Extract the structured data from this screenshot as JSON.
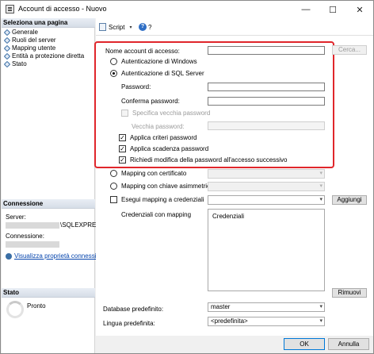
{
  "window": {
    "title": "Account di accesso - Nuovo",
    "minimize_glyph": "—",
    "maximize_glyph": "☐",
    "close_glyph": "✕"
  },
  "left_pane": {
    "select_page_header": "Seleziona una pagina",
    "pages": [
      {
        "label": "Generale",
        "icon": "wrench-icon"
      },
      {
        "label": "Ruoli del server",
        "icon": "wrench-icon"
      },
      {
        "label": "Mapping utente",
        "icon": "wrench-icon"
      },
      {
        "label": "Entità a protezione diretta",
        "icon": "wrench-icon"
      },
      {
        "label": "Stato",
        "icon": "wrench-icon"
      }
    ],
    "connection_header": "Connessione",
    "server_label": "Server:",
    "server_value": "\\SQLEXPRE",
    "connection_label": "Connessione:",
    "view_properties_link": "Visualizza proprietà connessione",
    "status_header": "Stato",
    "status_value": "Pronto"
  },
  "toolbar": {
    "script_label": "Script",
    "help_glyph": "?"
  },
  "form": {
    "login_name_label": "Nome account di accesso:",
    "login_name_value": "",
    "search_button": "Cerca...",
    "windows_auth_label": "Autenticazione di Windows",
    "sql_auth_label": "Autenticazione di SQL Server",
    "auth_mode": "sql",
    "password_label": "Password:",
    "confirm_password_label": "Conferma password:",
    "specify_old_password_label": "Specifica vecchia password",
    "old_password_label": "Vecchia password:",
    "enforce_policy_label": "Applica criteri password",
    "enforce_policy_checked": true,
    "enforce_expiration_label": "Applica scadenza password",
    "enforce_expiration_checked": true,
    "must_change_label": "Richiedi modifica della password all'accesso successivo",
    "must_change_checked": true,
    "mapped_cert_label": "Mapping con certificato",
    "mapped_asym_key_label": "Mapping con chiave asimmetrica",
    "map_credential_label": "Esegui mapping a credenziali",
    "add_button": "Aggiungi",
    "mapped_credentials_label": "Credenziali con mapping",
    "credentials_column": "Credenziali",
    "remove_button": "Rimuovi",
    "default_db_label": "Database predefinito:",
    "default_db_value": "master",
    "default_lang_label": "Lingua predefinita:",
    "default_lang_value": "<predefinita>",
    "check_glyph": "✓",
    "dropdown_glyph": "▾"
  },
  "footer": {
    "ok_button": "OK",
    "cancel_button": "Annulla"
  },
  "colors": {
    "highlight_border": "#e0262b",
    "link": "#0645ad",
    "header_gradient_top": "#e9eef5"
  }
}
